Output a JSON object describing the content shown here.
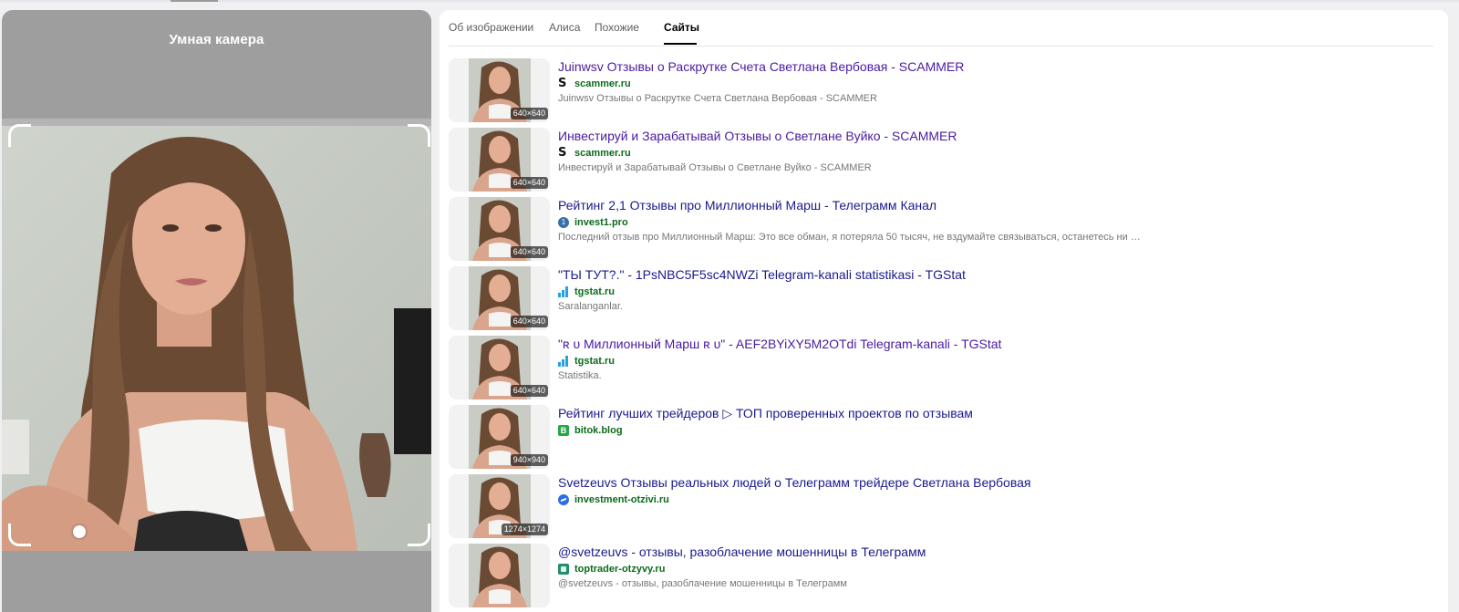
{
  "camera": {
    "title": "Умная камера"
  },
  "tabs": [
    {
      "label": "Об изображении",
      "active": false
    },
    {
      "label": "Алиса",
      "active": false
    },
    {
      "label": "Похожие",
      "active": false
    },
    {
      "label": "Сайты",
      "active": true
    }
  ],
  "results": [
    {
      "title": "Juinwsv Отзывы о Раскрутке Счета Светлана Вербовая - SCAMMER",
      "visited": true,
      "domain": "scammer.ru",
      "favicon": "scammer-s-icon",
      "description": "Juinwsv Отзывы о Раскрутке Счета Светлана Вербовая - SCAMMER",
      "dims": "640×640"
    },
    {
      "title": "Инвестируй и Зарабатывай Отзывы о Светлане Вуйко - SCAMMER",
      "visited": true,
      "domain": "scammer.ru",
      "favicon": "scammer-s-icon",
      "description": "Инвестируй и Зарабатывай Отзывы о Светлане Вуйко - SCAMMER",
      "dims": "640×640"
    },
    {
      "title": "Рейтинг 2,1 Отзывы про Миллионный Марш - Телеграмм Канал",
      "visited": false,
      "domain": "invest1.pro",
      "favicon": "invest1-icon",
      "description": "Последний отзыв про Миллионный Марш: Это все обман, я потеряла 50 тысяч, не вздумайте связываться, останетесь ни с чем...",
      "dims": "640×640"
    },
    {
      "title": "\"ТЫ ТУТ?.\" - 1PsNBC5F5sc4NWZi Telegram-kanali statistikasi - TGStat",
      "visited": false,
      "domain": "tgstat.ru",
      "favicon": "tgstat-bars-icon",
      "description": "Saralanganlar.",
      "dims": "640×640"
    },
    {
      "title": "\"ʀ ᴜ Миллионный Марш ʀ ᴜ\" - AEF2BYiXY5M2OTdi Telegram-kanali - TGStat",
      "visited": true,
      "domain": "tgstat.ru",
      "favicon": "tgstat-bars-icon",
      "description": "Statistika.",
      "dims": "640×640"
    },
    {
      "title": "Рейтинг лучших трейдеров ▷ ТОП проверенных проектов по отзывам",
      "visited": false,
      "domain": "bitok.blog",
      "favicon": "bitok-icon",
      "description": "",
      "dims": "940×940"
    },
    {
      "title": "Svetzeuvs Отзывы реальных людей о Телеграмм трейдере Светлана Вербовая",
      "visited": false,
      "domain": "investment-otzivi.ru",
      "favicon": "messenger-icon",
      "description": "",
      "dims": "1274×1274"
    },
    {
      "title": "@svetzeuvs - отзывы, разоблачение мошенницы в Телеграмм",
      "visited": false,
      "domain": "toptrader-otzyvy.ru",
      "favicon": "toptrader-icon",
      "description": "@svetzeuvs - отзывы, разоблачение мошенницы в Телеграмм",
      "dims": ""
    }
  ]
}
